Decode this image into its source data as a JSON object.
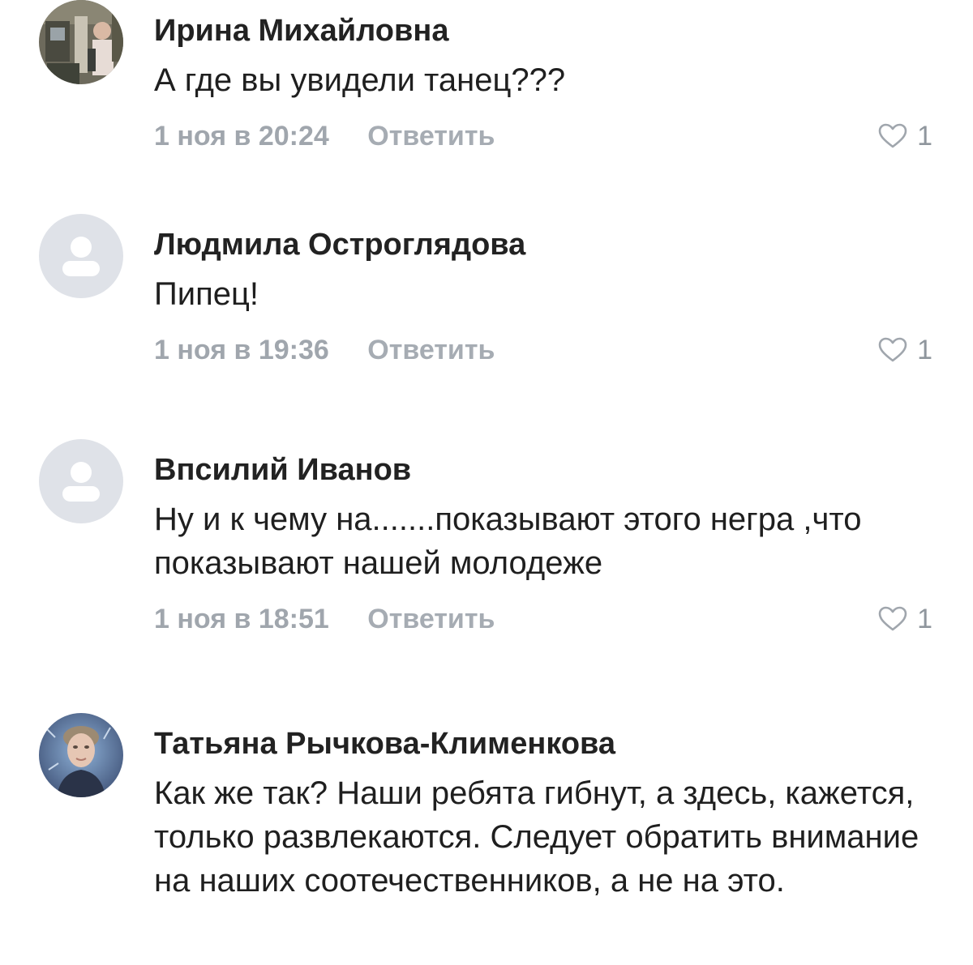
{
  "comments": [
    {
      "author": "Ирина Михайловна",
      "text": "А где вы увидели танец???",
      "time": "1 ноя в 20:24",
      "reply_label": "Ответить",
      "likes": "1",
      "avatar_icon": "user-photo-avatar"
    },
    {
      "author": "Людмила Остроглядова",
      "text": "Пипец!",
      "time": "1 ноя в 19:36",
      "reply_label": "Ответить",
      "likes": "1",
      "avatar_icon": "default-user-avatar-icon"
    },
    {
      "author": "Впсилий Иванов",
      "text": "Ну и к чему на.......показывают этого негра ,что показывают нашей молодеже",
      "time": "1 ноя в 18:51",
      "reply_label": "Ответить",
      "likes": "1",
      "avatar_icon": "default-user-avatar-icon"
    },
    {
      "author": "Татьяна Рычкова-Клименкова",
      "text": "Как же так? Наши ребята гибнут, а здесь, кажется, только развлекаются. Следует обратить внимание на наших соотечественников, а не на это.",
      "avatar_icon": "user-photo-avatar"
    }
  ],
  "colors": {
    "author": "#222222",
    "text": "#1f1f1f",
    "meta": "#a0a6ad",
    "default_avatar_bg": "#dfe2e8",
    "default_avatar_glyph": "#ffffff"
  }
}
